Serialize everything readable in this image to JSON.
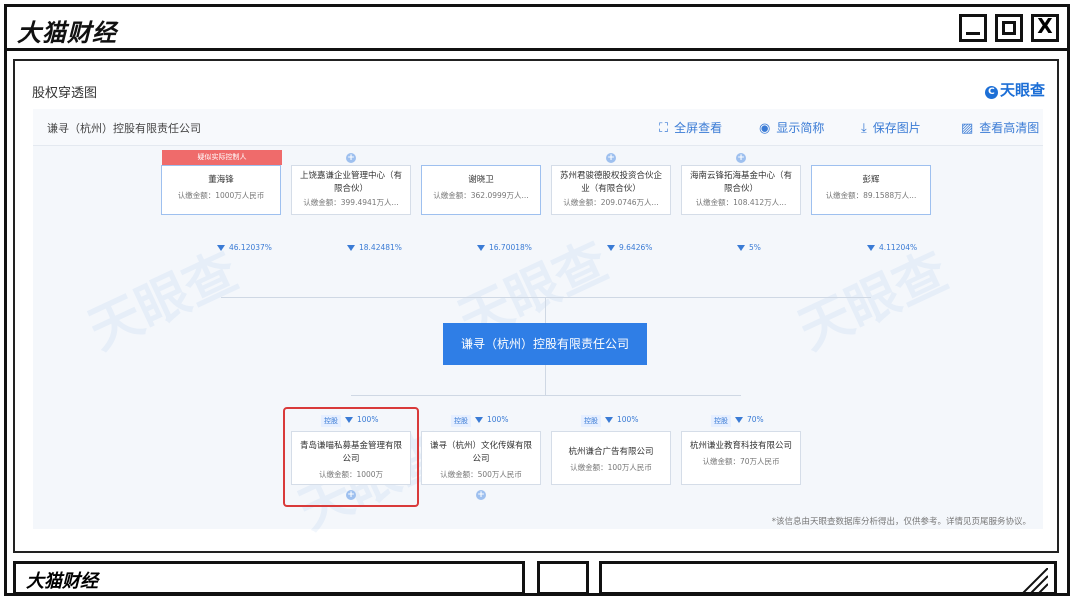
{
  "brand": "大猫财经",
  "window_buttons": {
    "close": "X"
  },
  "page_title": "股权穿透图",
  "logo": "天眼查",
  "watermark": "天眼查",
  "toolbar": {
    "company": "谦寻（杭州）控股有限责任公司",
    "fullscreen": "全屏查看",
    "short_name": "显示简称",
    "save_image": "保存图片",
    "hd": "查看高清图"
  },
  "shareholders": [
    {
      "name": "董海锋",
      "amount": "认缴金额：1000万人民币",
      "pct": "46.12037%",
      "tag": "疑似实际控制人"
    },
    {
      "name": "上饶嘉谦企业管理中心（有限合伙）",
      "amount": "认缴金额：399.4941万人...",
      "pct": "18.42481%"
    },
    {
      "name": "谢晓卫",
      "amount": "认缴金额：362.0999万人...",
      "pct": "16.70018%"
    },
    {
      "name": "苏州君骏德股权投资合伙企业（有限合伙）",
      "amount": "认缴金额：209.0746万人...",
      "pct": "9.6426%"
    },
    {
      "name": "海南云锋拓海基金中心（有限合伙）",
      "amount": "认缴金额：108.412万人...",
      "pct": "5%"
    },
    {
      "name": "彭辉",
      "amount": "认缴金额：89.1588万人...",
      "pct": "4.11204%"
    }
  ],
  "center_company": "谦寻（杭州）控股有限责任公司",
  "subsidiaries": [
    {
      "ctrl": "控股",
      "pct": "100%",
      "name": "青岛谦喵私募基金管理有限公司",
      "amount": "认缴金额：1000万"
    },
    {
      "ctrl": "控股",
      "pct": "100%",
      "name": "谦寻（杭州）文化传媒有限公司",
      "amount": "认缴金额：500万人民币"
    },
    {
      "ctrl": "控股",
      "pct": "100%",
      "name": "杭州谦合广告有限公司",
      "amount": "认缴金额：100万人民币"
    },
    {
      "ctrl": "控股",
      "pct": "70%",
      "name": "杭州谦业教育科技有限公司",
      "amount": "认缴金额：70万人民币"
    }
  ],
  "footnote": "*该信息由天眼查数据库分析得出，仅供参考。详情见页尾服务协议。",
  "bottom_brand": "大猫财经"
}
